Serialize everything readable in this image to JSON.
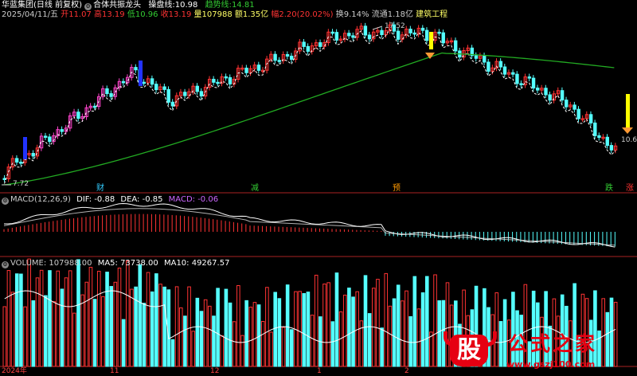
{
  "header": {
    "stock_name": "华蓝集团",
    "adjust_mode": "(日线 前复权)",
    "indicator_name": "合体共振龙头",
    "line1_label": "操盘线:",
    "line1_value": "10.98",
    "line2_label": "趋势线:",
    "line2_value": "14.81",
    "date": "2025/04/11/五",
    "open": "开11.07",
    "high": "高13.19",
    "low": "低10.96",
    "close": "收13.19",
    "volume": "量107988",
    "amount": "额1.35亿",
    "change": "幅2.20(20.02%)",
    "turnover": "换9.14%",
    "float_cap": "流通1.18亿",
    "sector": "建筑工程"
  },
  "main_panel": {
    "price_labels": {
      "high": "17.52",
      "low": "7.72",
      "last": "10.6"
    },
    "signal_labels": [
      {
        "text": "财",
        "color": "#33ccff"
      },
      {
        "text": "减",
        "color": "#33cc33"
      },
      {
        "text": "预",
        "color": "#ff9900"
      },
      {
        "text": "跌",
        "color": "#33cc33"
      },
      {
        "text": "涨",
        "color": "#ff3333"
      }
    ]
  },
  "macd_panel": {
    "title": "MACD(12,26,9)",
    "dif": "DIF: -0.88",
    "dea": "DEA: -0.85",
    "macd": "MACD: -0.06"
  },
  "volume_panel": {
    "title": "VOLUME: 107988.00",
    "ma5": "MA5: 73738.00",
    "ma10": "MA10: 49267.57"
  },
  "x_axis": {
    "labels": [
      "2024年",
      "11",
      "12",
      "1",
      "2"
    ]
  },
  "watermark": {
    "logo_char": "股",
    "text": "公式之家",
    "url": "www.gszj100.com"
  },
  "colors": {
    "up": "#ff3333",
    "down": "#55ffff",
    "magenta": "#ff44cc",
    "trend": "#22aa22",
    "accent_yellow": "#ffff00"
  }
}
